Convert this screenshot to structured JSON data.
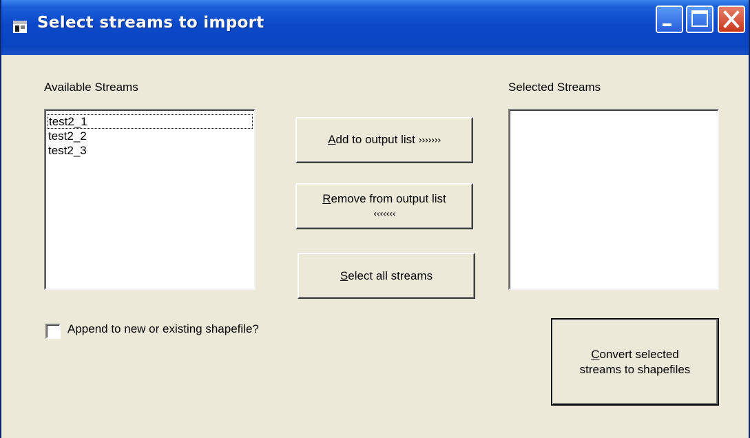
{
  "window": {
    "title": "Select streams to import"
  },
  "available": {
    "label": "Available Streams",
    "items": [
      "test2_1",
      "test2_2",
      "test2_3"
    ]
  },
  "selected": {
    "label": "Selected Streams",
    "items": []
  },
  "buttons": {
    "add": {
      "mnemonic": "A",
      "rest": "dd to output list",
      "arrows": "›››››››"
    },
    "remove": {
      "mnemonic": "R",
      "rest": "emove from output list",
      "arrows": "‹‹‹‹‹‹‹"
    },
    "select_all": {
      "mnemonic": "S",
      "rest": "elect all streams"
    },
    "convert": {
      "mnemonic": "C",
      "line1_rest": "onvert selected",
      "line2": "streams to shapefiles"
    }
  },
  "append": {
    "label": "Append to new or existing shapefile?",
    "checked": false
  },
  "colors": {
    "titlebar": "#0a44c0",
    "window_bg": "#ece9d8",
    "close_button": "#c8381c"
  }
}
